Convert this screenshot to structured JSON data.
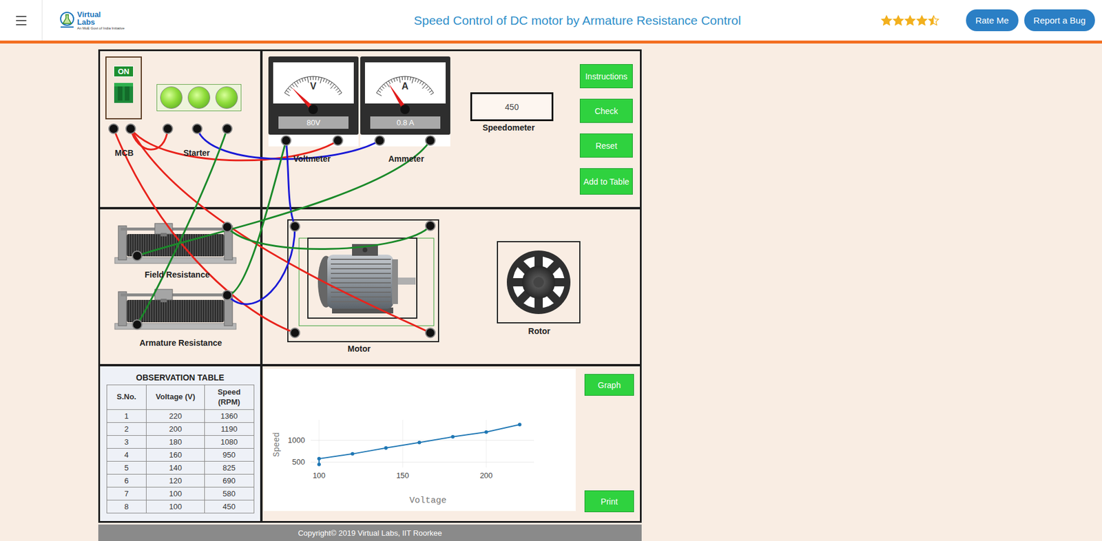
{
  "header": {
    "logo": {
      "line1": "Virtual",
      "line2": "Labs",
      "tagline": "An MoE Govt of India Initiative"
    },
    "title": "Speed Control of DC motor by Armature Resistance Control",
    "rating": {
      "stars": 4.5,
      "max": 5
    },
    "buttons": [
      "Rate Me",
      "Report a Bug"
    ]
  },
  "apparatus": {
    "mcb": {
      "label": "MCB",
      "switch": "ON",
      "on": true
    },
    "lamps": [
      {
        "on": true
      },
      {
        "on": true
      },
      {
        "on": true
      }
    ],
    "starter": {
      "label": "Starter"
    },
    "voltmeter": {
      "symbol": "V",
      "reading": "80V",
      "label": "Voltmeter",
      "level": 0.13
    },
    "ammeter": {
      "symbol": "A",
      "reading": "0.8 A",
      "label": "Ammeter",
      "level": 0.23
    },
    "speedometer": {
      "reading": "450",
      "label": "Speedometer"
    },
    "field_resistance": {
      "label": "Field Resistance"
    },
    "armature_resistance": {
      "label": "Armature Resistance"
    },
    "motor": {
      "label": "Motor"
    },
    "rotor": {
      "label": "Rotor"
    },
    "wires": [
      {
        "color": "#e8231c"
      },
      {
        "color": "#e8231c"
      },
      {
        "color": "#e8231c"
      },
      {
        "color": "#e8231c"
      },
      {
        "color": "#1a1ad6"
      },
      {
        "color": "#1a1ad6"
      },
      {
        "color": "#1a1ad6"
      },
      {
        "color": "#1b8a2a"
      },
      {
        "color": "#1b8a2a"
      },
      {
        "color": "#1b8a2a"
      },
      {
        "color": "#1b8a2a"
      }
    ]
  },
  "controls": [
    "Instructions",
    "Check",
    "Reset",
    "Add to Table"
  ],
  "observation_table": {
    "title": "OBSERVATION TABLE",
    "columns": [
      "S.No.",
      "Voltage (V)",
      "Speed (RPM)"
    ],
    "rows": [
      [
        "1",
        "220",
        "1360"
      ],
      [
        "2",
        "200",
        "1190"
      ],
      [
        "3",
        "180",
        "1080"
      ],
      [
        "4",
        "160",
        "950"
      ],
      [
        "5",
        "140",
        "825"
      ],
      [
        "6",
        "120",
        "690"
      ],
      [
        "7",
        "100",
        "580"
      ],
      [
        "8",
        "100",
        "450"
      ]
    ]
  },
  "chart": {
    "x_label": "Voltage",
    "y_label": "Speed",
    "x_ticks": [
      "100",
      "150",
      "200"
    ],
    "y_ticks": [
      "500",
      "1000"
    ],
    "series": [
      {
        "x": [
          220,
          200,
          180,
          160,
          140,
          120,
          100,
          100
        ],
        "y": [
          1360,
          1190,
          1080,
          950,
          825,
          690,
          580,
          450
        ]
      }
    ]
  },
  "chart_buttons": [
    "Graph",
    "Print"
  ],
  "footer": "Copyright© 2019 Virtual Labs, IIT Roorkee"
}
